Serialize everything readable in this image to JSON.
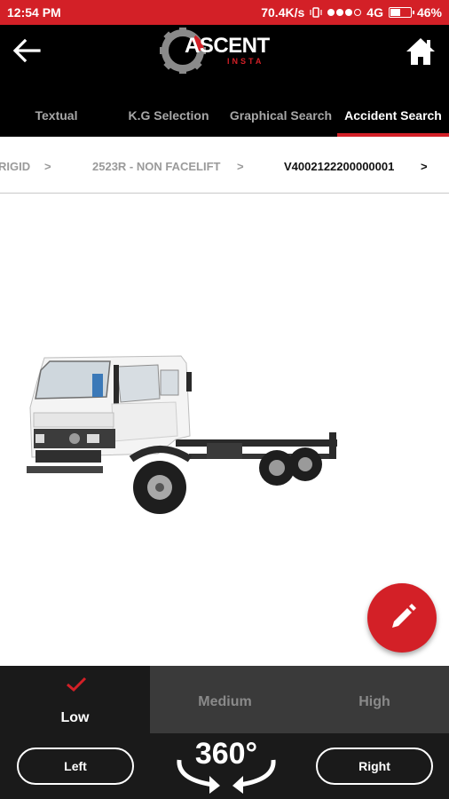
{
  "status_bar": {
    "time": "12:54 PM",
    "net_speed": "70.4K/s",
    "network": "4G",
    "battery": "46%"
  },
  "app_bar": {
    "logo_text": "ASCENT",
    "logo_sub": "INSTA",
    "back_icon": "back-arrow-icon",
    "home_icon": "home-icon"
  },
  "tabs": [
    {
      "label": "Textual"
    },
    {
      "label": "K.G Selection"
    },
    {
      "label": "Graphical Search"
    },
    {
      "label": "Accident Search"
    }
  ],
  "breadcrumb": [
    {
      "label": "RIGID",
      "sep": ">"
    },
    {
      "label": "2523R - NON FACELIFT",
      "sep": ">"
    },
    {
      "label": "V4002122200000001",
      "sep": ">"
    }
  ],
  "fab": {
    "icon": "pencil-icon"
  },
  "severity": [
    {
      "label": "Low",
      "selected": true
    },
    {
      "label": "Medium",
      "selected": false
    },
    {
      "label": "High",
      "selected": false
    }
  ],
  "rotation": {
    "left_label": "Left",
    "right_label": "Right",
    "degrees_label": "360°"
  },
  "colors": {
    "accent": "#d32027",
    "appbar": "#000000",
    "bottom_panel": "#1a1a1a"
  }
}
